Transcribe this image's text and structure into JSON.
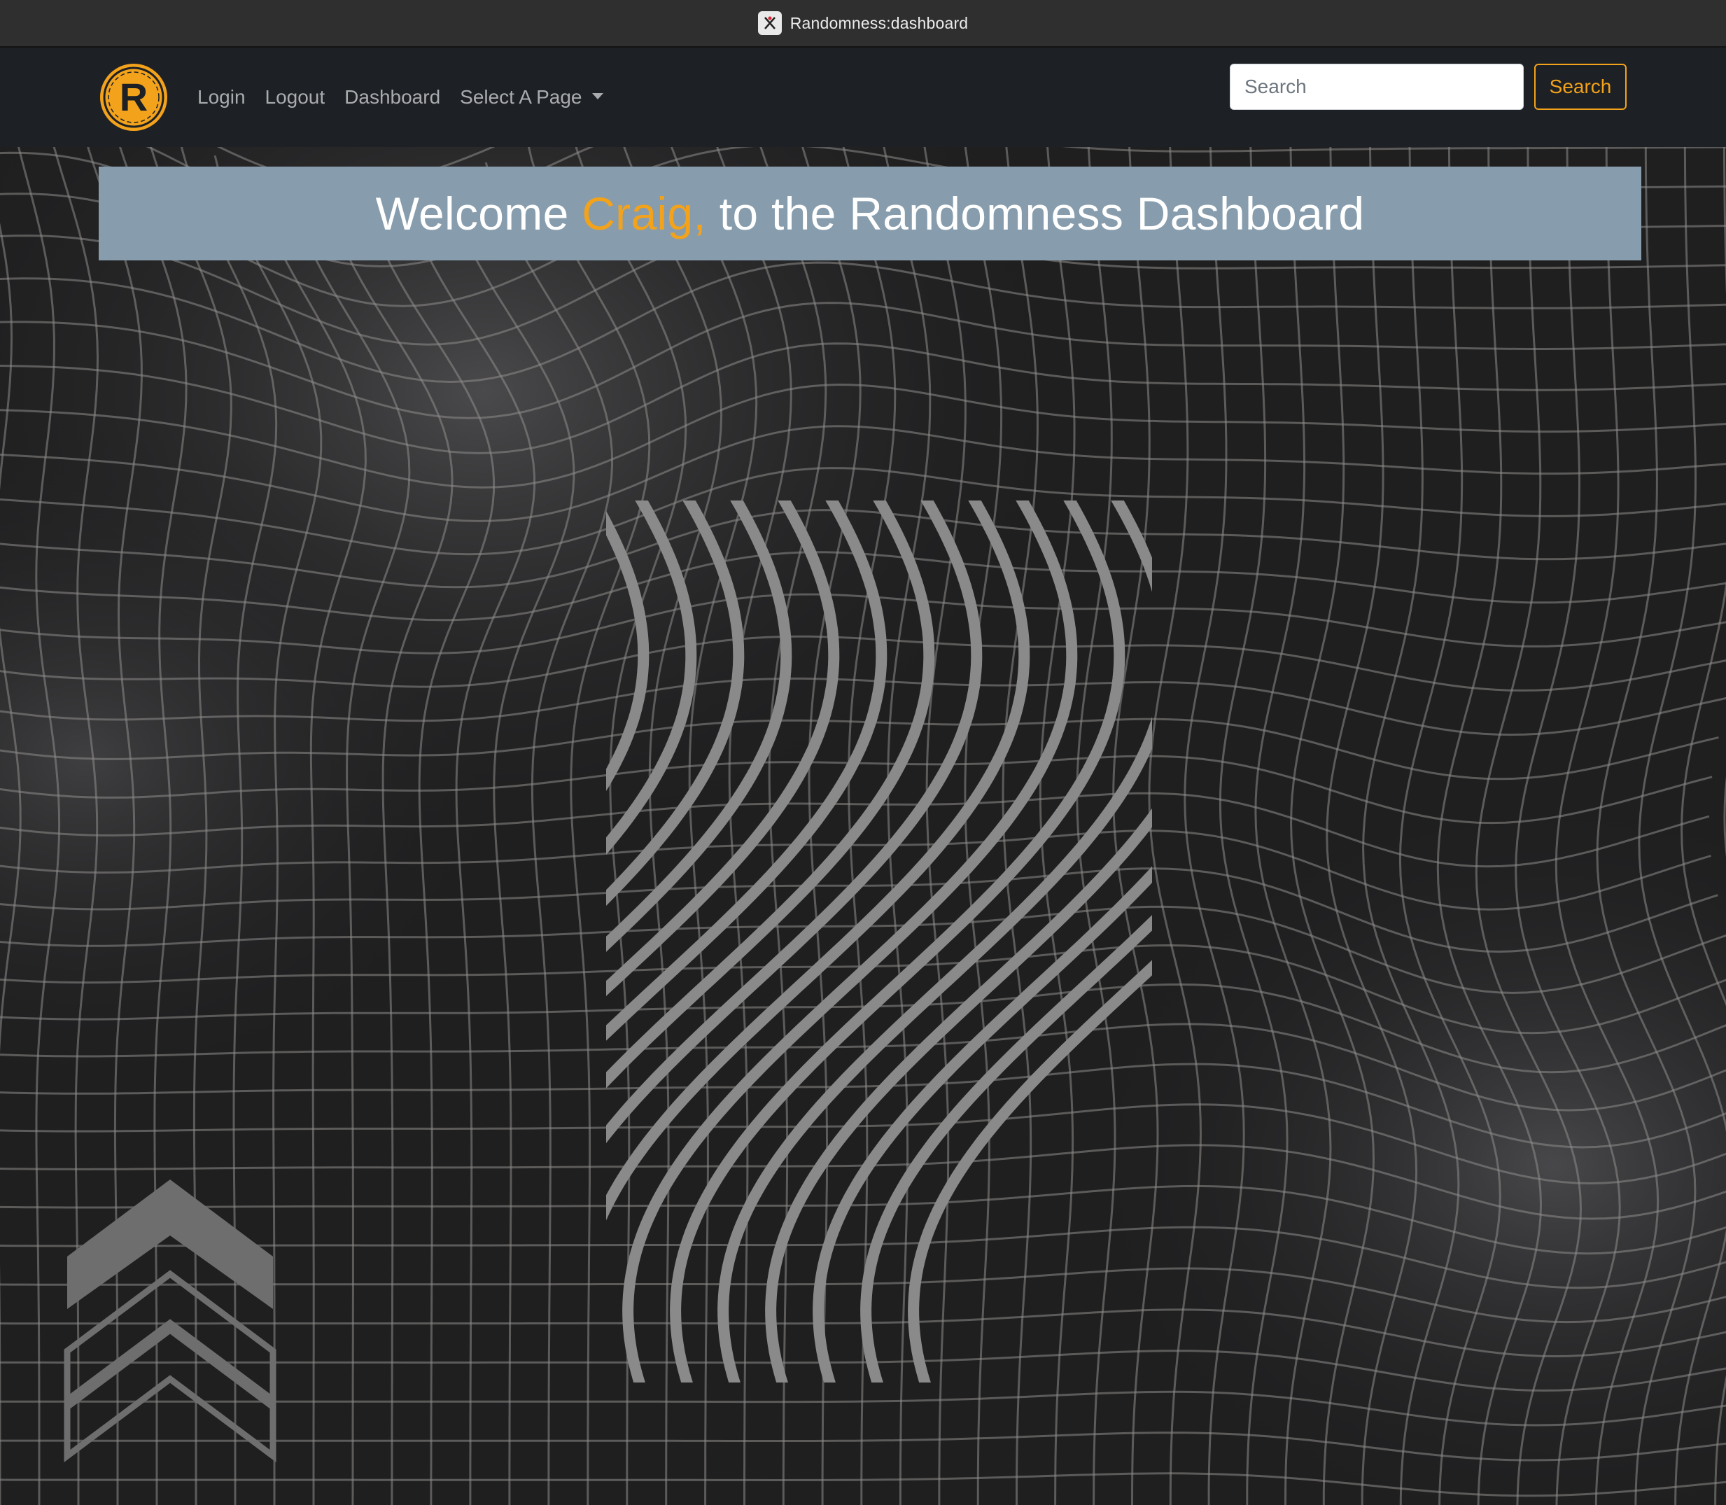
{
  "window": {
    "title": "Randomness:dashboard"
  },
  "navbar": {
    "logo_letter": "R",
    "links": [
      "Login",
      "Logout",
      "Dashboard"
    ],
    "dropdown_label": "Select A Page",
    "search": {
      "placeholder": "Search",
      "value": "",
      "button_label": "Search"
    }
  },
  "welcome": {
    "prefix": "Welcome",
    "name": "Craig,",
    "suffix": "to the Randomness Dashboard"
  },
  "theme": {
    "accent": "#f3a21b",
    "navbar_bg": "#1d2024",
    "banner_bg": "#879dad",
    "page_bg": "#1f1f20"
  }
}
